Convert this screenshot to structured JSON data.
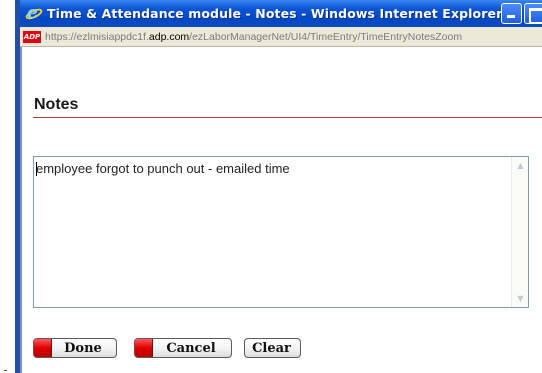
{
  "window": {
    "title": "Time & Attendance module - Notes - Windows Internet Explorer"
  },
  "address_bar": {
    "url_prefix": "https://ezlmisiappdc1f.",
    "url_host": "adp.com",
    "url_path": "/ezLaborManagerNet/UI4/TimeEntry/TimeEntryNotesZoom",
    "site_icon": "adp-icon",
    "site_icon_text": "ADP"
  },
  "page": {
    "heading": "Notes",
    "note_text": "employee forgot to punch out - emailed time"
  },
  "buttons": {
    "done": "Done",
    "cancel": "Cancel",
    "clear": "Clear"
  },
  "colors": {
    "titlebar": "#0548c6",
    "heading_rule": "#b33c3c",
    "button_cap": "#e00000"
  }
}
